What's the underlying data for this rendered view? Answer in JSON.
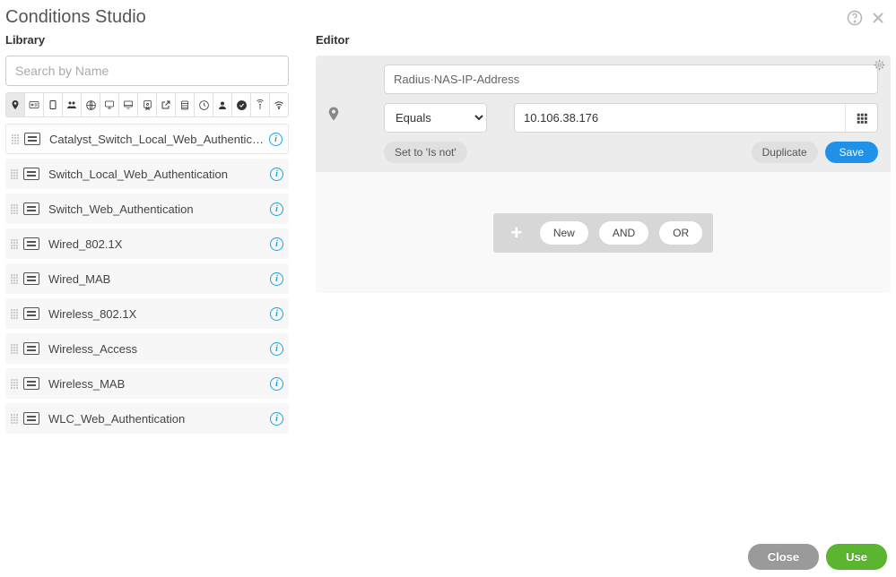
{
  "title": "Conditions Studio",
  "library": {
    "label": "Library",
    "search_placeholder": "Search by Name",
    "items": [
      {
        "label": "Catalyst_Switch_Local_Web_Authentication"
      },
      {
        "label": "Switch_Local_Web_Authentication"
      },
      {
        "label": "Switch_Web_Authentication"
      },
      {
        "label": "Wired_802.1X"
      },
      {
        "label": "Wired_MAB"
      },
      {
        "label": "Wireless_802.1X"
      },
      {
        "label": "Wireless_Access"
      },
      {
        "label": "Wireless_MAB"
      },
      {
        "label": "WLC_Web_Authentication"
      }
    ]
  },
  "editor": {
    "label": "Editor",
    "attribute": "Radius·NAS-IP-Address",
    "operator": "Equals",
    "value": "10.106.38.176",
    "set_to_is_not": "Set to 'Is not'",
    "duplicate": "Duplicate",
    "save": "Save",
    "logic": {
      "new": "New",
      "and": "AND",
      "or": "OR"
    }
  },
  "footer": {
    "close": "Close",
    "use": "Use"
  }
}
